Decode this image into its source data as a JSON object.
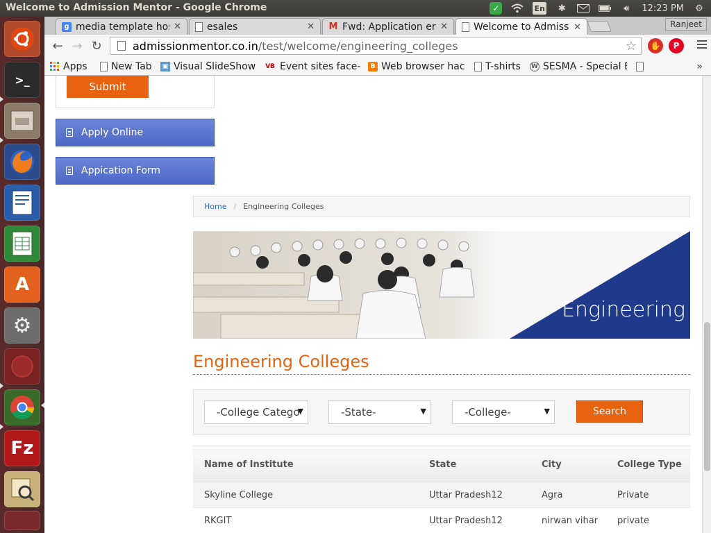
{
  "window": {
    "title": "Welcome to Admission Mentor - Google Chrome"
  },
  "tray": {
    "lang": "En",
    "time": "12:23 PM"
  },
  "browser": {
    "user": "Ranjeet",
    "tabs": [
      {
        "label": "media template hos",
        "icon": "google-icon"
      },
      {
        "label": "esales",
        "icon": "page-icon"
      },
      {
        "label": "Fwd: Application err",
        "icon": "gmail-icon"
      },
      {
        "label": "Welcome to Admissi",
        "icon": "page-icon"
      }
    ],
    "url_host": "admissionmentor.co.in",
    "url_path": "/test/welcome/engineering_colleges",
    "bookmarks": [
      {
        "label": "Apps",
        "icon": "apps-grid-icon"
      },
      {
        "label": "New Tab",
        "icon": "page-icon"
      },
      {
        "label": "Visual SlideShow",
        "icon": "slideshow-icon"
      },
      {
        "label": "Event sites face-c",
        "icon": "vb-icon"
      },
      {
        "label": "Web browser hac",
        "icon": "blogger-icon"
      },
      {
        "label": "T-shirts",
        "icon": "page-icon"
      },
      {
        "label": "SESMA - Special E",
        "icon": "wordpress-icon"
      }
    ],
    "bookmarks_more": "»"
  },
  "sidebar": {
    "submit_label": "Submit",
    "apply_online": "Apply Online",
    "application_form": "Appication Form"
  },
  "breadcrumb": {
    "home": "Home",
    "separator": "/",
    "current": "Engineering Colleges"
  },
  "banner": {
    "text": "Engineering"
  },
  "main": {
    "heading": "Engineering Colleges",
    "filters": {
      "category": "-College Catego",
      "state": "-State-",
      "college": "-College-",
      "search_label": "Search"
    },
    "table": {
      "headers": [
        "Name of Institute",
        "State",
        "City",
        "College Type"
      ],
      "rows": [
        [
          "Skyline College",
          "Uttar Pradesh12",
          "Agra",
          "Private"
        ],
        [
          "RKGIT",
          "Uttar Pradesh12",
          "nirwan vihar",
          "private"
        ]
      ]
    }
  },
  "colors": {
    "accent": "#e8620f",
    "sidebar_button": "#5570cc",
    "banner_blue": "#1f3a8a",
    "launcher": "#4f2828"
  }
}
